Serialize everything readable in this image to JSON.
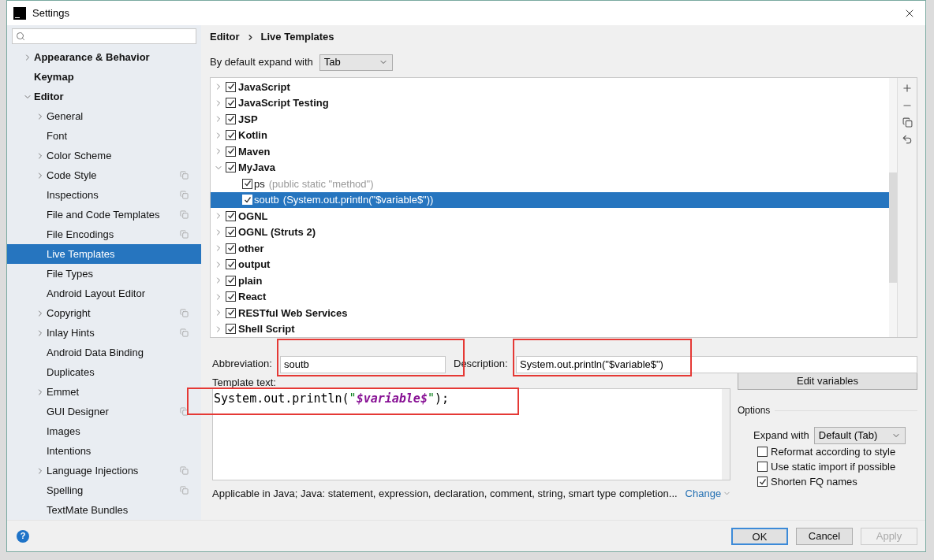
{
  "window": {
    "title": "Settings"
  },
  "help": "?",
  "sidebar": {
    "items": [
      {
        "label": "Appearance & Behavior",
        "expanded": false,
        "project": false,
        "selected": false
      },
      {
        "label": "Keymap",
        "project": false,
        "selected": false
      },
      {
        "label": "Editor",
        "expanded": true,
        "project": false,
        "selected": false,
        "children": [
          {
            "label": "General",
            "expanded": false,
            "project": false,
            "selected": false
          },
          {
            "label": "Font",
            "project": false,
            "selected": false
          },
          {
            "label": "Color Scheme",
            "expanded": false,
            "project": false,
            "selected": false
          },
          {
            "label": "Code Style",
            "expanded": false,
            "project": true,
            "selected": false
          },
          {
            "label": "Inspections",
            "project": true,
            "selected": false
          },
          {
            "label": "File and Code Templates",
            "project": true,
            "selected": false
          },
          {
            "label": "File Encodings",
            "project": true,
            "selected": false
          },
          {
            "label": "Live Templates",
            "project": false,
            "selected": true
          },
          {
            "label": "File Types",
            "project": false,
            "selected": false
          },
          {
            "label": "Android Layout Editor",
            "project": false,
            "selected": false
          },
          {
            "label": "Copyright",
            "expanded": false,
            "project": true,
            "selected": false
          },
          {
            "label": "Inlay Hints",
            "expanded": false,
            "project": true,
            "selected": false
          },
          {
            "label": "Android Data Binding",
            "project": false,
            "selected": false
          },
          {
            "label": "Duplicates",
            "project": false,
            "selected": false
          },
          {
            "label": "Emmet",
            "expanded": false,
            "project": false,
            "selected": false
          },
          {
            "label": "GUI Designer",
            "project": true,
            "selected": false
          },
          {
            "label": "Images",
            "project": false,
            "selected": false
          },
          {
            "label": "Intentions",
            "project": false,
            "selected": false
          },
          {
            "label": "Language Injections",
            "expanded": false,
            "project": true,
            "selected": false
          },
          {
            "label": "Spelling",
            "project": true,
            "selected": false
          },
          {
            "label": "TextMate Bundles",
            "project": false,
            "selected": false
          }
        ]
      }
    ]
  },
  "breadcrumb": [
    "Editor",
    "Live Templates"
  ],
  "expand_default": {
    "label": "By default expand with",
    "value": "Tab"
  },
  "templates": [
    {
      "name": "JavaScript",
      "checked": true,
      "expanded": false
    },
    {
      "name": "JavaScript Testing",
      "checked": true,
      "expanded": false
    },
    {
      "name": "JSP",
      "checked": true,
      "expanded": false
    },
    {
      "name": "Kotlin",
      "checked": true,
      "expanded": false
    },
    {
      "name": "Maven",
      "checked": true,
      "expanded": false
    },
    {
      "name": "MyJava",
      "checked": true,
      "expanded": true,
      "children": [
        {
          "abbreviation": "ps",
          "description": "(public static \"method\")",
          "checked": true,
          "selected": false
        },
        {
          "abbreviation": "soutb",
          "description": "(System.out.println(\"$variable$\"))",
          "checked": true,
          "selected": true
        }
      ]
    },
    {
      "name": "OGNL",
      "checked": true,
      "expanded": false
    },
    {
      "name": "OGNL (Struts 2)",
      "checked": true,
      "expanded": false
    },
    {
      "name": "other",
      "checked": true,
      "expanded": false
    },
    {
      "name": "output",
      "checked": true,
      "expanded": false
    },
    {
      "name": "plain",
      "checked": true,
      "expanded": false
    },
    {
      "name": "React",
      "checked": true,
      "expanded": false
    },
    {
      "name": "RESTful Web Services",
      "checked": true,
      "expanded": false
    },
    {
      "name": "Shell Script",
      "checked": true,
      "expanded": false
    }
  ],
  "abbreviation": {
    "label": "Abbreviation:",
    "value": "soutb",
    "highlighted": true
  },
  "description": {
    "label": "Description:",
    "value": "System.out.println(\"$variable$\")",
    "highlighted": true
  },
  "template_text": {
    "label": "Template text:",
    "highlighted": true,
    "segments": [
      {
        "kind": "plain",
        "text": "System.out.println("
      },
      {
        "kind": "string",
        "text": "\""
      },
      {
        "kind": "variable",
        "text": "$variable$"
      },
      {
        "kind": "string",
        "text": "\""
      },
      {
        "kind": "plain",
        "text": ");"
      }
    ]
  },
  "edit_variables": "Edit variables",
  "options": {
    "title": "Options",
    "expand_label": "Expand with",
    "expand_value": "Default (Tab)",
    "checks": [
      {
        "label": "Reformat according to style",
        "checked": false
      },
      {
        "label": "Use static import if possible",
        "checked": false
      },
      {
        "label": "Shorten FQ names",
        "checked": true
      }
    ]
  },
  "applicable": {
    "text": "Applicable in Java; Java: statement, expression, declaration, comment, string, smart type completion...",
    "link": "Change"
  },
  "buttons": [
    {
      "label": "OK",
      "kind": "default"
    },
    {
      "label": "Cancel",
      "kind": "normal"
    },
    {
      "label": "Apply",
      "kind": "disabled"
    }
  ]
}
